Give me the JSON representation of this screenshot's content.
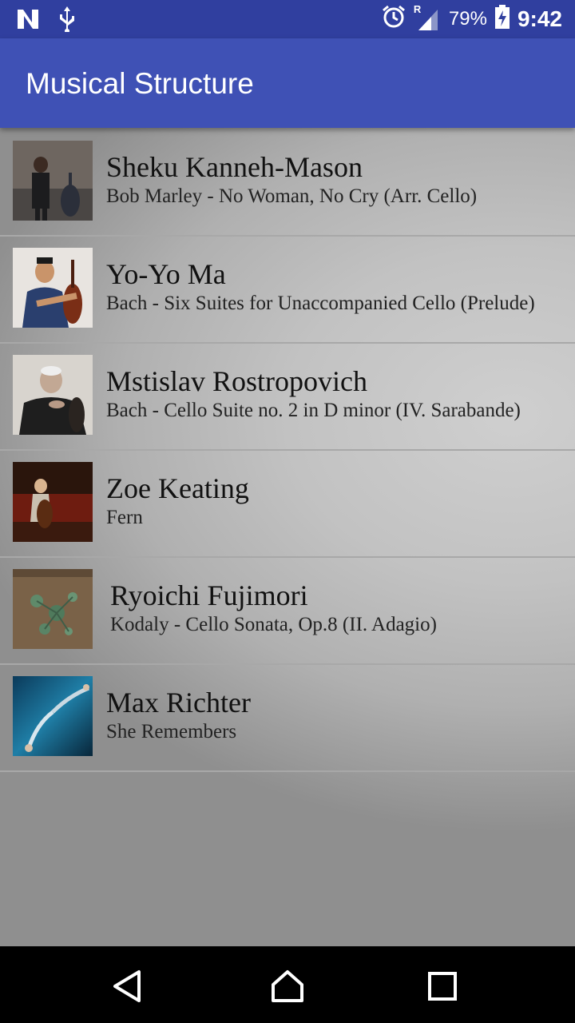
{
  "status_bar": {
    "battery_percent": "79%",
    "time": "9:42",
    "roaming_indicator": "R",
    "left_icons": [
      "n-notification-icon",
      "usb-icon"
    ],
    "right_icons": [
      "alarm-icon",
      "signal-icon",
      "battery-charging-icon"
    ]
  },
  "app_bar": {
    "title": "Musical Structure"
  },
  "tracks": [
    {
      "artist": "Sheku Kanneh-Mason",
      "piece": "Bob Marley - No Woman, No Cry (Arr. Cello)"
    },
    {
      "artist": "Yo-Yo Ma",
      "piece": "Bach - Six Suites for Unaccompanied Cello (Prelude)"
    },
    {
      "artist": "Mstislav Rostropovich",
      "piece": "Bach - Cello Suite no. 2 in D minor (IV. Sarabande)"
    },
    {
      "artist": "Zoe Keating",
      "piece": "Fern"
    },
    {
      "artist": "Ryoichi Fujimori",
      "piece": "Kodaly - Cello Sonata, Op.8 (II. Adagio)"
    },
    {
      "artist": "Max Richter",
      "piece": "She Remembers"
    }
  ],
  "nav_bar": {
    "icons": [
      "back-icon",
      "home-icon",
      "recents-icon"
    ]
  },
  "colors": {
    "status_bar": "#303f9f",
    "app_bar": "#3f51b5",
    "nav_bar": "#000000"
  }
}
